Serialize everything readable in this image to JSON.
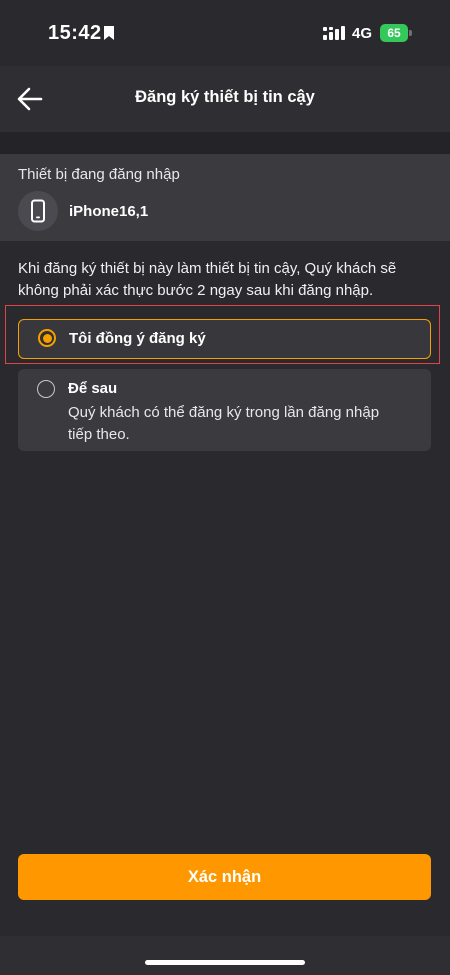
{
  "status_bar": {
    "time": "15:42",
    "network": "4G",
    "battery": "65",
    "bookmark_icon": "bookmark-icon",
    "signal_icon": "cellular-signal-icon",
    "battery_color": "#34c759"
  },
  "header": {
    "title": "Đăng ký thiết bị tin cậy",
    "back_icon": "arrow-left-icon"
  },
  "device": {
    "caption": "Thiết bị đang đăng nhập",
    "name": "iPhone16,1",
    "icon": "smartphone-icon"
  },
  "description": "Khi đăng ký thiết bị này làm thiết bị tin cậy, Quý khách sẽ không phải xác thực bước 2 ngay sau khi đăng nhập.",
  "options": [
    {
      "label": "Tôi đồng ý đăng ký",
      "selected": true
    },
    {
      "label": "Để sau",
      "description": "Quý khách có thể đăng ký trong lần đăng nhập tiếp theo.",
      "selected": false
    }
  ],
  "confirm_button": {
    "label": "Xác nhận"
  },
  "colors": {
    "accent": "#ff9800",
    "background": "#2a2a2e",
    "card": "#3a3a3f",
    "highlight_border": "#e0444a"
  }
}
